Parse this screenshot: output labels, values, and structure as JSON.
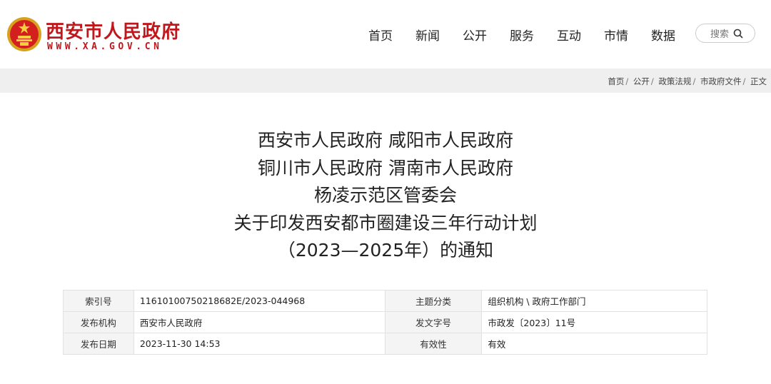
{
  "site": {
    "name": "西安市人民政府",
    "url": "WWW.XA.GOV.CN"
  },
  "nav": [
    "首页",
    "新闻",
    "公开",
    "服务",
    "互动",
    "市情",
    "数据"
  ],
  "search": {
    "label": "搜索"
  },
  "breadcrumb": [
    "首页",
    "公开",
    "政策法规",
    "市政府文件",
    "正文"
  ],
  "title_lines": [
    "西安市人民政府 咸阳市人民政府",
    "铜川市人民政府 渭南市人民政府",
    "杨凌示范区管委会",
    "关于印发西安都市圈建设三年行动计划",
    "（2023—2025年）的通知"
  ],
  "info_table": [
    [
      "索引号",
      "11610100750218682E/2023-044968",
      "主题分类",
      "组织机构 \\ 政府工作部门"
    ],
    [
      "发布机构",
      "西安市人民政府",
      "发文字号",
      "市政发〔2023〕11号"
    ],
    [
      "发布日期",
      "2023-11-30 14:53",
      "有效性",
      "有效"
    ]
  ],
  "colors": {
    "brand": "#c0171c",
    "crumb_bg": "#efefef",
    "label_bg": "#f4f4f4"
  }
}
